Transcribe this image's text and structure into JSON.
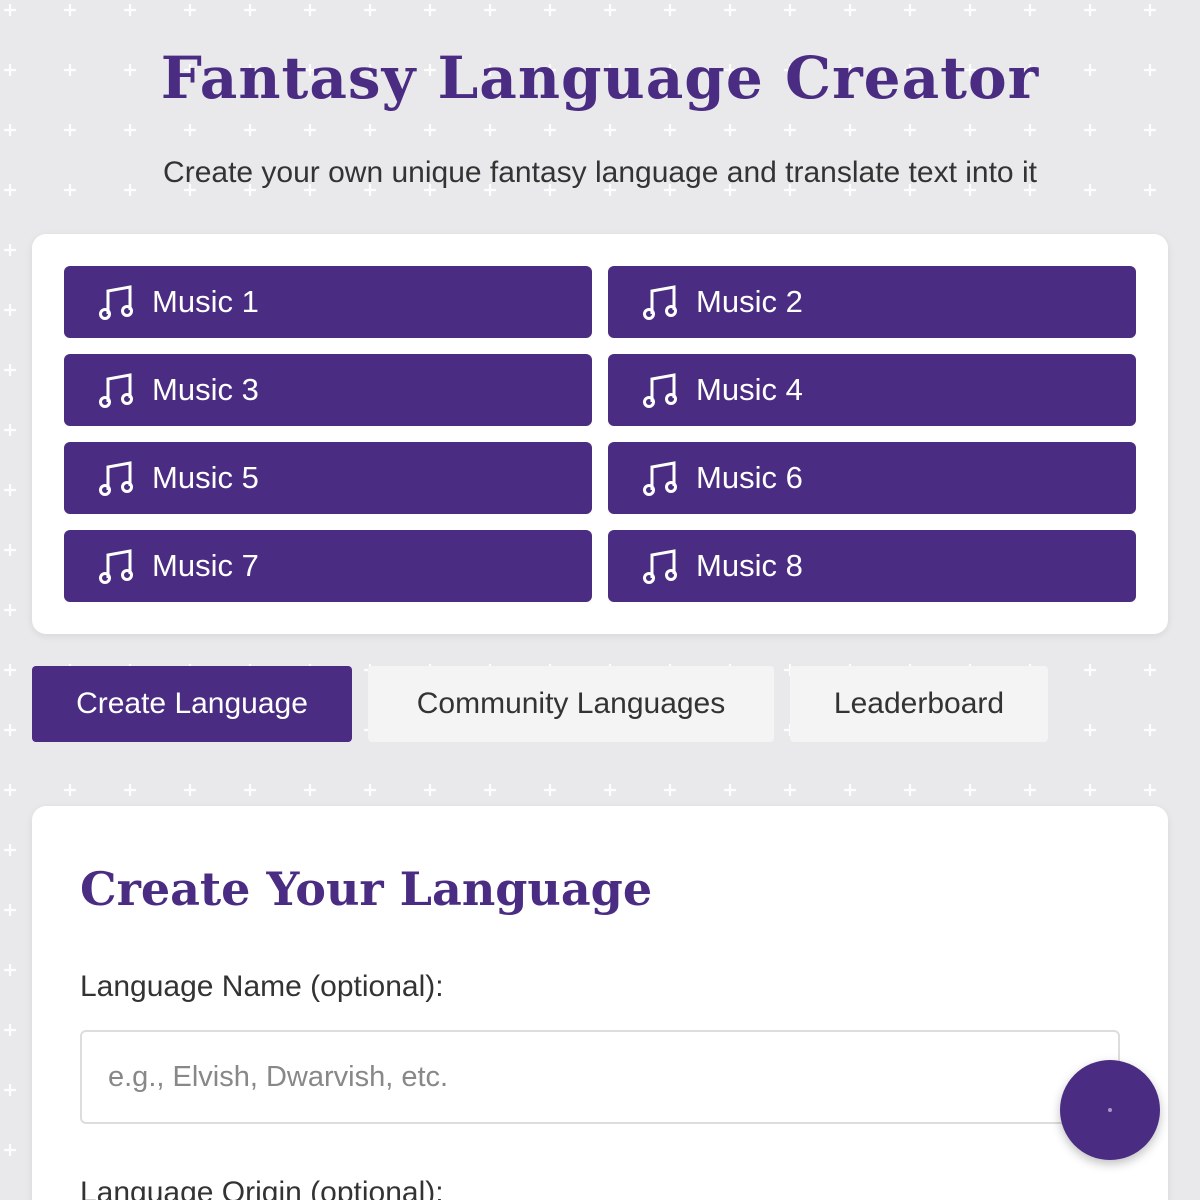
{
  "header": {
    "title": "Fantasy Language Creator",
    "subtitle": "Create your own unique fantasy language and translate text into it"
  },
  "music": {
    "icon": "music-note-icon",
    "buttons": [
      {
        "label": "Music 1"
      },
      {
        "label": "Music 2"
      },
      {
        "label": "Music 3"
      },
      {
        "label": "Music 4"
      },
      {
        "label": "Music 5"
      },
      {
        "label": "Music 6"
      },
      {
        "label": "Music 7"
      },
      {
        "label": "Music 8"
      }
    ]
  },
  "tabs": [
    {
      "label": "Create Language",
      "active": true
    },
    {
      "label": "Community Languages",
      "active": false
    },
    {
      "label": "Leaderboard",
      "active": false
    }
  ],
  "create": {
    "title": "Create Your Language",
    "name_label": "Language Name (optional):",
    "name_placeholder": "e.g., Elvish, Dwarvish, etc.",
    "name_value": "",
    "origin_label": "Language Origin (optional):"
  },
  "colors": {
    "accent": "#4a2c82",
    "background": "#e9e9eb",
    "panel": "#ffffff",
    "inactive_tab": "#f4f4f4"
  },
  "fab": {
    "icon": "loading-dot-icon"
  }
}
